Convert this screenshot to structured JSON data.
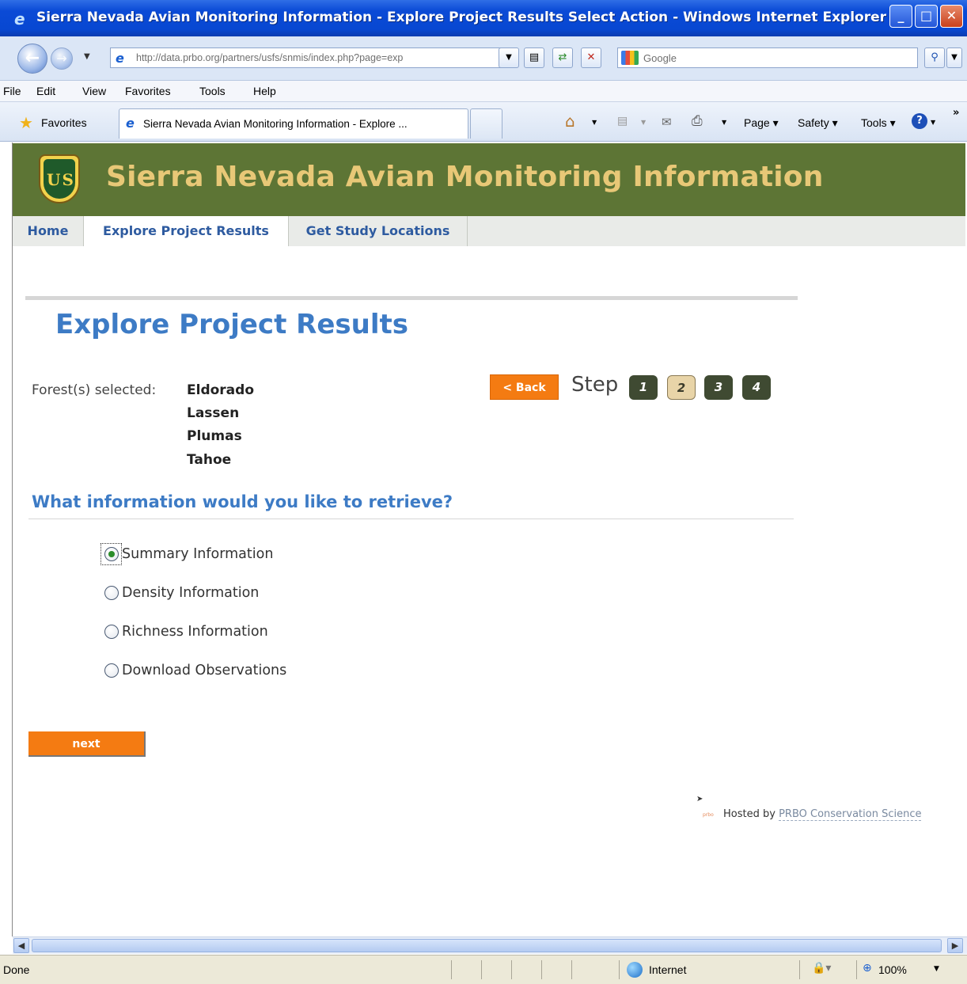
{
  "window": {
    "title": "Sierra Nevada Avian Monitoring Information - Explore Project Results Select Action - Windows Internet Explorer",
    "minimize_glyph": "_",
    "maximize_glyph": "□",
    "close_glyph": "✕"
  },
  "addressbar": {
    "url": "http://data.prbo.org/partners/usfs/snmis/index.php?page=exp",
    "search_placeholder": "Google"
  },
  "menu": {
    "items": [
      "File",
      "Edit",
      "View",
      "Favorites",
      "Tools",
      "Help"
    ]
  },
  "favorites_bar": {
    "favorites_label": "Favorites",
    "tab_title": "Sierra Nevada Avian Monitoring Information - Explore ...",
    "commands": [
      "Page ▾",
      "Safety ▾",
      "Tools ▾"
    ]
  },
  "site": {
    "banner_title": "Sierra Nevada Avian Monitoring Information",
    "logo_letters": "US",
    "nav": [
      "Home",
      "Explore Project Results",
      "Get Study Locations"
    ],
    "active_nav": "Explore Project Results",
    "heading": "Explore Project Results",
    "forest_label": "Forest(s) selected:",
    "forests": [
      "Eldorado",
      "Lassen",
      "Plumas",
      "Tahoe"
    ],
    "back_label": "< Back",
    "step_label": "Step",
    "steps": [
      "1",
      "2",
      "3",
      "4"
    ],
    "current_step": "2",
    "question": "What information would you like to retrieve?",
    "options": [
      "Summary Information",
      "Density Information",
      "Richness Information",
      "Download Observations"
    ],
    "selected_option": "Summary Information",
    "next_label": "next",
    "hosted_by": "Hosted by",
    "hosted_link": "PRBO Conservation Science"
  },
  "statusbar": {
    "status": "Done",
    "zone": "Internet",
    "zoom": "100%"
  },
  "colors": {
    "banner_bg": "#5d7535",
    "banner_text": "#e8c877",
    "heading_blue": "#3d7bc5",
    "orange_button": "#f47b12"
  }
}
